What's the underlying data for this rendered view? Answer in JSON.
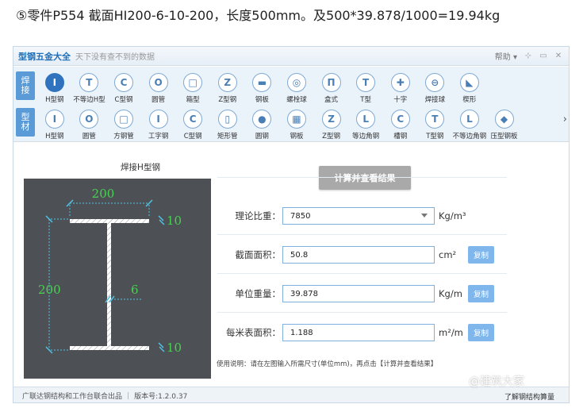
{
  "caption": "⑤零件P554 截面HI200-6-10-200，长度500mm。及500*39.878/1000=19.94kg",
  "window": {
    "title": "型钢五金大全",
    "slogan": "天下没有查不到的数据",
    "help_label": "帮助",
    "controls": [
      "pin-icon",
      "minimize-icon",
      "close-icon"
    ]
  },
  "toolbar": {
    "row1_tab": [
      "焊",
      "接"
    ],
    "row2_tab": [
      "型",
      "材"
    ],
    "row1": [
      {
        "label": "H型钢",
        "glyph": "I",
        "active": true
      },
      {
        "label": "不等边H型",
        "glyph": "T"
      },
      {
        "label": "C型钢",
        "glyph": "C"
      },
      {
        "label": "圆管",
        "glyph": "O"
      },
      {
        "label": "箱型",
        "glyph": "□"
      },
      {
        "label": "Z型钢",
        "glyph": "Z"
      },
      {
        "label": "钢板",
        "glyph": "▬"
      },
      {
        "label": "螺栓球",
        "glyph": "◎"
      },
      {
        "label": "盒式",
        "glyph": "Π"
      },
      {
        "label": "T型",
        "glyph": "T"
      },
      {
        "label": "十字",
        "glyph": "✚"
      },
      {
        "label": "焊接球",
        "glyph": "⊖"
      },
      {
        "label": "楔形",
        "glyph": "◣"
      }
    ],
    "row2": [
      {
        "label": "H型钢",
        "glyph": "I"
      },
      {
        "label": "圆管",
        "glyph": "O"
      },
      {
        "label": "方钢管",
        "glyph": "□"
      },
      {
        "label": "工字钢",
        "glyph": "I"
      },
      {
        "label": "C型钢",
        "glyph": "C"
      },
      {
        "label": "矩形管",
        "glyph": "▯"
      },
      {
        "label": "圆钢",
        "glyph": "●"
      },
      {
        "label": "钢板",
        "glyph": "▦"
      },
      {
        "label": "Z型钢",
        "glyph": "Z"
      },
      {
        "label": "等边角钢",
        "glyph": "L"
      },
      {
        "label": "槽钢",
        "glyph": "C"
      },
      {
        "label": "T型钢",
        "glyph": "T"
      },
      {
        "label": "不等边角钢",
        "glyph": "L"
      },
      {
        "label": "压型钢板",
        "glyph": "◆"
      }
    ]
  },
  "diagram": {
    "title": "焊接H型钢",
    "flange_width": "200",
    "height": "200",
    "web_thickness": "6",
    "top_flange_thickness": "10",
    "bottom_flange_thickness": "10"
  },
  "calc_button": "计算并查看结果",
  "fields": {
    "density": {
      "label": "理论比重：",
      "value": "7850",
      "unit": "Kg/m³"
    },
    "area": {
      "label": "截面面积：",
      "value": "50.8",
      "unit": "cm²",
      "copy": "复制"
    },
    "unit_weight": {
      "label": "单位重量：",
      "value": "39.878",
      "unit": "Kg/m",
      "copy": "复制"
    },
    "surface": {
      "label": "每米表面积：",
      "value": "1.188",
      "unit": "m²/m",
      "copy": "复制"
    }
  },
  "usage": "使用说明：请在左图输入所需尺寸(单位mm)，再点击【计算并查看结果】",
  "statusbar": {
    "publisher": "广联达钢结构和工作台联合出品",
    "version": "版本号:1.2.0.37",
    "learn_more": "了解钢结构算量"
  },
  "watermark": "@建筑大家"
}
